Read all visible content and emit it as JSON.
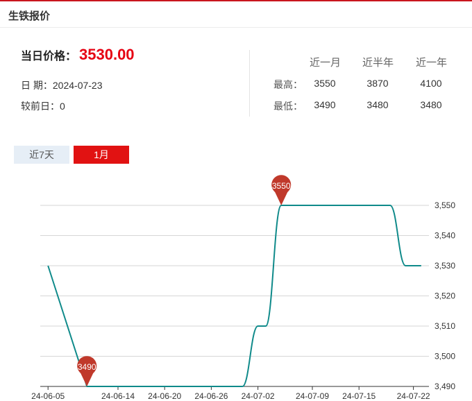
{
  "header": {
    "title": "生铁报价"
  },
  "price": {
    "label": "当日价格：",
    "value": "3530.00"
  },
  "info": {
    "date_label": "日 期：",
    "date": "2024-07-23",
    "change_label": "较前日：",
    "change": "0"
  },
  "stats": {
    "columns": [
      "近一月",
      "近半年",
      "近一年"
    ],
    "rows": [
      {
        "label": "最高：",
        "values": [
          "3550",
          "3870",
          "4100"
        ]
      },
      {
        "label": "最低：",
        "values": [
          "3490",
          "3480",
          "3480"
        ]
      }
    ]
  },
  "tabs": {
    "week": "近7天",
    "month": "1月"
  },
  "colors": {
    "line": "#0f8a8a",
    "accent": "#e60012",
    "marker": "#c0392b"
  },
  "chart_data": {
    "type": "line",
    "x_ticks": [
      "24-06-05",
      "24-06-14",
      "24-06-20",
      "24-06-26",
      "24-07-02",
      "24-07-09",
      "24-07-15",
      "24-07-22"
    ],
    "y_ticks": [
      "3,490",
      "3,500",
      "3,510",
      "3,520",
      "3,530",
      "3,540",
      "3,550"
    ],
    "ylim": [
      3490,
      3550
    ],
    "x": [
      "2024-06-05",
      "2024-06-10",
      "2024-06-30",
      "2024-07-02",
      "2024-07-03",
      "2024-07-05",
      "2024-07-19",
      "2024-07-21",
      "2024-07-23"
    ],
    "y": [
      3530,
      3490,
      3490,
      3510,
      3510,
      3550,
      3550,
      3530,
      3530
    ],
    "markers": [
      {
        "label": "3490",
        "x": "2024-06-10",
        "y": 3490
      },
      {
        "label": "3550",
        "x": "2024-07-05",
        "y": 3550
      }
    ],
    "grid": true
  }
}
